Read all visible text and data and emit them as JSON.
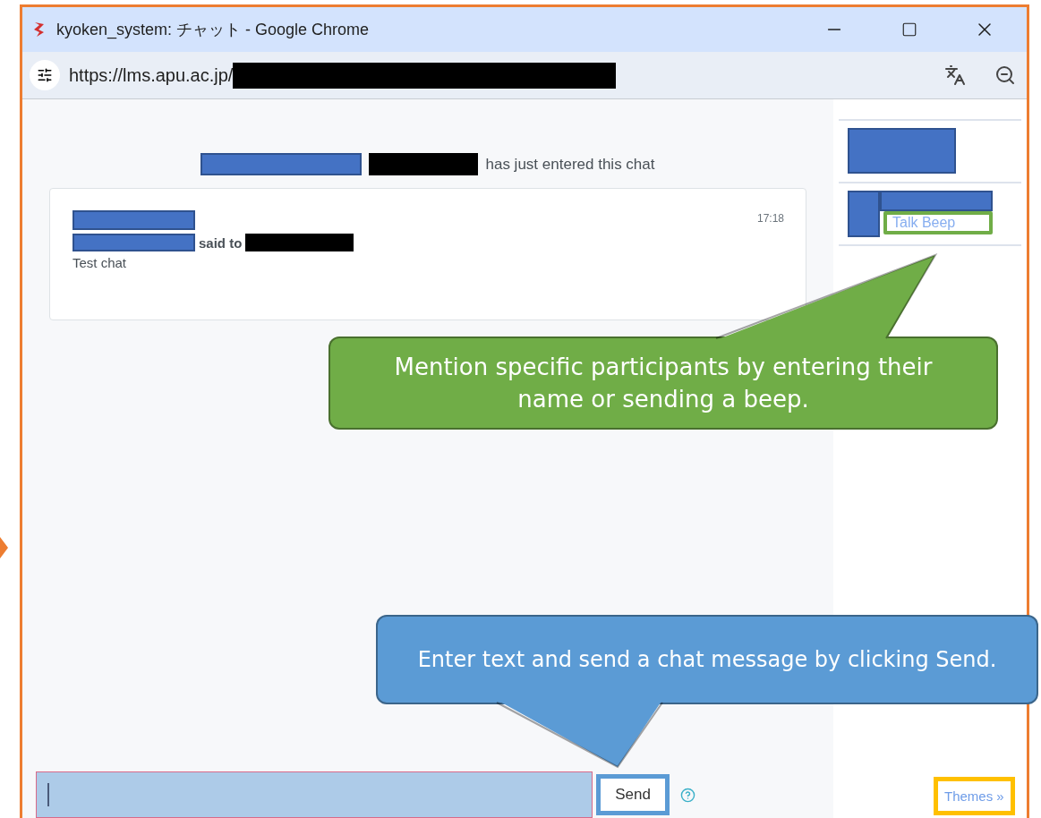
{
  "window": {
    "title": "kyoken_system: チャット - Google Chrome"
  },
  "address_bar": {
    "url": "https://lms.apu.ac.jp/"
  },
  "chat": {
    "system_message": "has just entered this chat",
    "messages": [
      {
        "time": "17:18",
        "said_to": "said to",
        "text": "Test chat"
      }
    ]
  },
  "participants": [
    {
      "kind": "name"
    },
    {
      "kind": "name_with_link",
      "link": "Talk Beep"
    }
  ],
  "composer": {
    "send": "Send",
    "themes": "Themes »"
  },
  "callouts": [
    {
      "kind": "up",
      "text": "Mention specific participants by entering their name or sending a beep.",
      "color": "#70ad47"
    },
    {
      "kind": "down",
      "text": "Enter text and send a chat message by clicking Send.",
      "color": "#5b9bd5"
    }
  ]
}
